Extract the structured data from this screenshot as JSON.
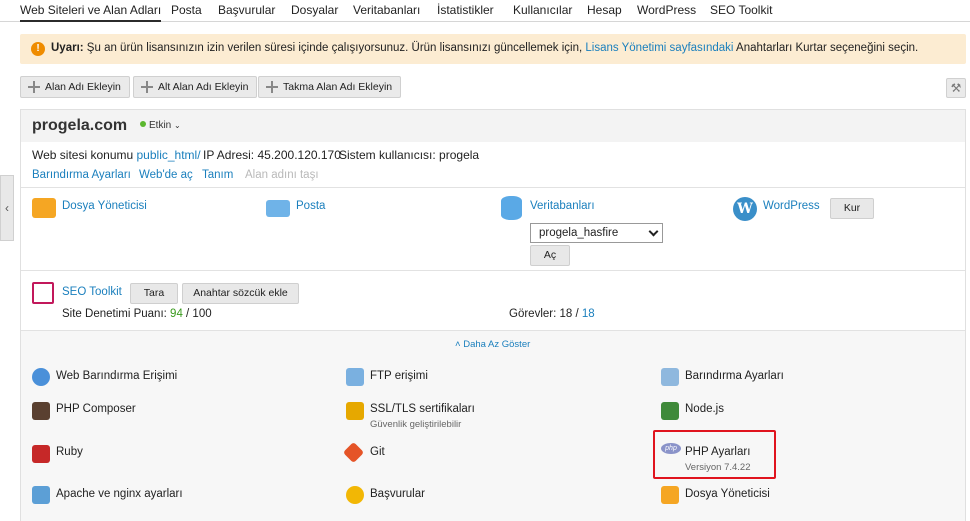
{
  "nav": {
    "tabs": [
      "Web Siteleri ve Alan Adları",
      "Posta",
      "Başvurular",
      "Dosyalar",
      "Veritabanları",
      "İstatistikler",
      "Kullanıcılar",
      "Hesap",
      "WordPress",
      "SEO Toolkit"
    ]
  },
  "warning": {
    "prefix": "Uyarı:",
    "text": " Şu an ürün lisansınızın izin verilen süresi içinde çalışıyorsunuz. Ürün lisansınızı güncellemek için, ",
    "link": "Lisans Yönetimi sayfasındaki",
    "suffix": " Anahtarları Kurtar seçeneğini seçin."
  },
  "toolbar": {
    "add_domain": "Alan Adı Ekleyin",
    "add_subdomain": "Alt Alan Adı Ekleyin",
    "add_alias": "Takma Alan Adı Ekleyin"
  },
  "domain": {
    "name": "progela.com",
    "status": "Etkin",
    "location_label": "Web sitesi konumu",
    "location_value": "public_html/",
    "ip_label": "IP Adresi:",
    "ip_value": "45.200.120.170",
    "user_label": "Sistem kullanıcısı:",
    "user_value": "progela",
    "links": [
      "Barındırma Ayarları",
      "Web'de aç",
      "Tanım",
      "Alan adını taşı"
    ]
  },
  "quick": {
    "file_manager": "Dosya Yöneticisi",
    "mail": "Posta",
    "databases": "Veritabanları",
    "db_selected": "progela_hasfire",
    "db_open": "Aç",
    "wordpress": "WordPress",
    "wp_install": "Kur"
  },
  "seo": {
    "title": "SEO Toolkit",
    "scan": "Tara",
    "add_keyword": "Anahtar sözcük ekle",
    "score_label": "Site Denetimi Puanı:",
    "score_value": "94",
    "score_total": " / 100",
    "tasks_label": "Görevler:",
    "tasks_value": "18 /",
    "tasks_link": "18"
  },
  "show_less": "Daha Az Göster",
  "tools": {
    "col1": [
      "Web Barındırma Erişimi",
      "PHP Composer",
      "Ruby",
      "Apache ve nginx ayarları"
    ],
    "col2": [
      "FTP erişimi",
      "SSL/TLS sertifikaları",
      "Git",
      "Başvurular"
    ],
    "col2_sub": "Güvenlik geliştirilebilir",
    "col3": [
      "Barındırma Ayarları",
      "Node.js",
      "PHP Ayarları",
      "Dosya Yöneticisi"
    ],
    "col3_sub": "Versiyon 7.4.22"
  },
  "colors": {
    "accent": "#1a7fbd",
    "warning_bg": "#fcecd2",
    "highlight": "#e0141e",
    "active_green": "#5bb72e"
  }
}
